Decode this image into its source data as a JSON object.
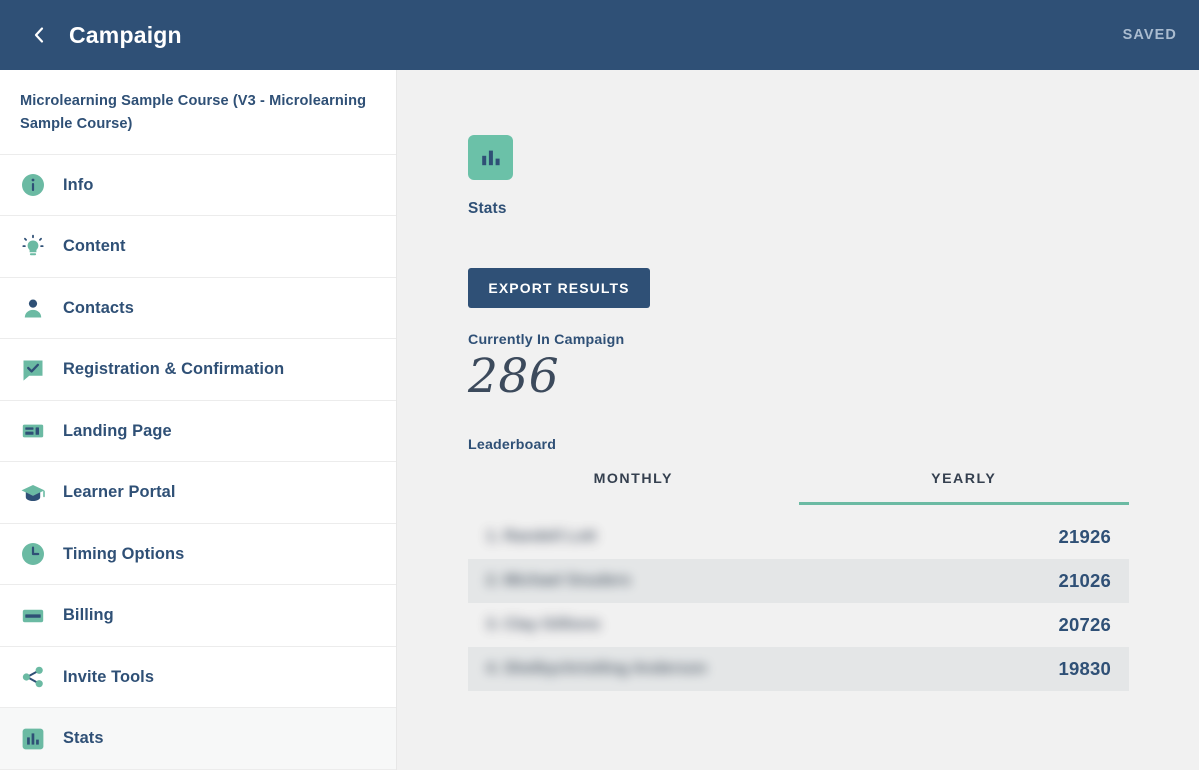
{
  "header": {
    "back_icon": "chevron-left-icon",
    "title": "Campaign",
    "status": "SAVED"
  },
  "sidebar": {
    "course_title": "Microlearning Sample Course (V3 - Microlearning Sample Course)",
    "items": [
      {
        "label": "Info",
        "icon": "info-circle-icon",
        "active": false
      },
      {
        "label": "Content",
        "icon": "lightbulb-icon",
        "active": false
      },
      {
        "label": "Contacts",
        "icon": "person-icon",
        "active": false
      },
      {
        "label": "Registration & Confirmation",
        "icon": "speech-bubble-check-icon",
        "active": false
      },
      {
        "label": "Landing Page",
        "icon": "landing-page-icon",
        "active": false
      },
      {
        "label": "Learner Portal",
        "icon": "graduation-cap-icon",
        "active": false
      },
      {
        "label": "Timing Options",
        "icon": "clock-icon",
        "active": false
      },
      {
        "label": "Billing",
        "icon": "credit-card-icon",
        "active": false
      },
      {
        "label": "Invite Tools",
        "icon": "share-icon",
        "active": false
      },
      {
        "label": "Stats",
        "icon": "bar-chart-icon",
        "active": true
      }
    ]
  },
  "main": {
    "page_icon": "bar-chart-icon",
    "page_title": "Stats",
    "export_button": "EXPORT RESULTS",
    "currently_in_campaign_label": "Currently In Campaign",
    "currently_in_campaign_value": "286",
    "leaderboard_label": "Leaderboard",
    "leaderboard_tabs": [
      {
        "label": "MONTHLY",
        "active": false
      },
      {
        "label": "YEARLY",
        "active": true
      }
    ],
    "leaderboard_rows": [
      {
        "name": "1. Randell Lott",
        "score": "21926"
      },
      {
        "name": "2. Michael Snuders",
        "score": "21026"
      },
      {
        "name": "3. Clay Gillions",
        "score": "20726"
      },
      {
        "name": "4. Shelbychristling Anderson",
        "score": "19830"
      }
    ]
  },
  "colors": {
    "navy": "#2f5076",
    "teal": "#6bbaa3",
    "tile_teal": "#6bc1a8",
    "page_bg": "#f1f1f1",
    "row_alt": "#e4e6e7",
    "saved_text": "#aabcd0"
  }
}
